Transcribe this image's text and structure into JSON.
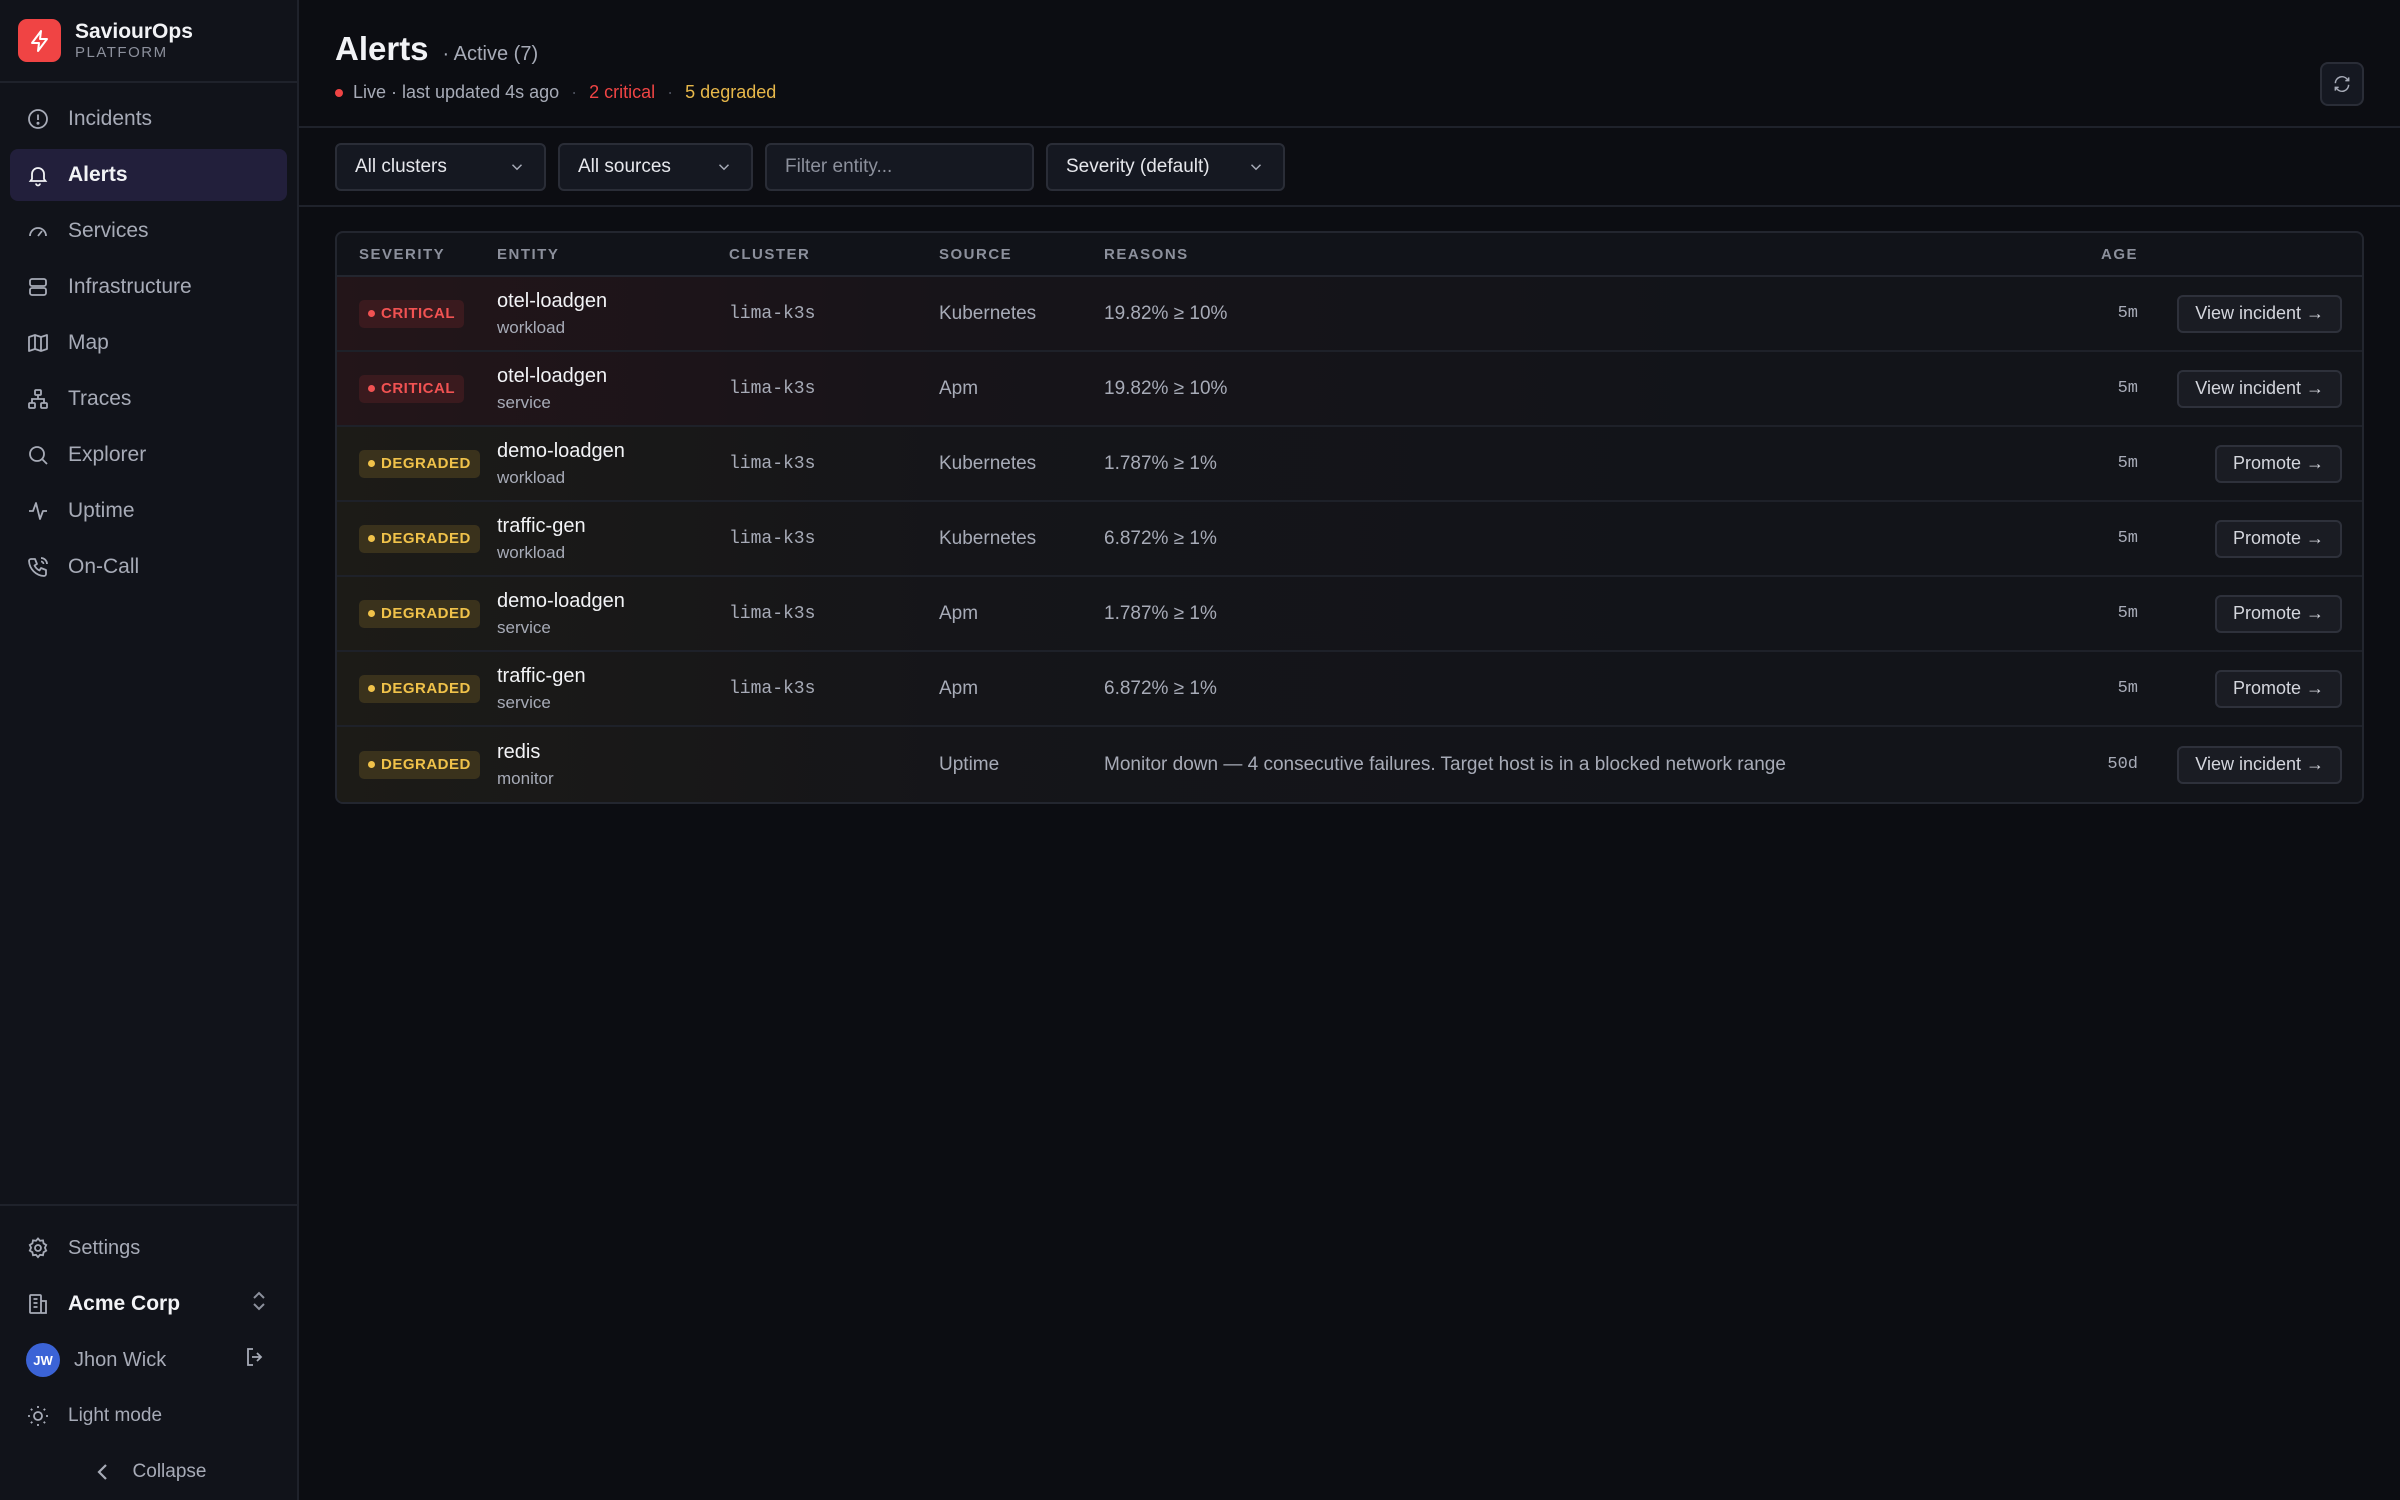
{
  "brand": {
    "name": "SaviourOps",
    "sub": "PLATFORM"
  },
  "nav": [
    {
      "label": "Incidents",
      "icon": "alert-circle-icon",
      "active": false
    },
    {
      "label": "Alerts",
      "icon": "bell-icon",
      "active": true
    },
    {
      "label": "Services",
      "icon": "gauge-icon",
      "active": false
    },
    {
      "label": "Infrastructure",
      "icon": "server-icon",
      "active": false
    },
    {
      "label": "Map",
      "icon": "map-icon",
      "active": false
    },
    {
      "label": "Traces",
      "icon": "network-icon",
      "active": false
    },
    {
      "label": "Explorer",
      "icon": "search-icon",
      "active": false
    },
    {
      "label": "Uptime",
      "icon": "activity-icon",
      "active": false
    },
    {
      "label": "On-Call",
      "icon": "phone-icon",
      "active": false
    }
  ],
  "bottom": {
    "settings": "Settings",
    "org": "Acme Corp",
    "user": {
      "initials": "JW",
      "name": "Jhon Wick"
    },
    "theme": "Light mode",
    "collapse": "Collapse"
  },
  "header": {
    "title": "Alerts",
    "subtitle": "· Active (7)",
    "live": "Live · last updated 4s ago",
    "sep": "·",
    "critical": "2 critical",
    "degraded": "5 degraded"
  },
  "filters": {
    "cluster": "All clusters",
    "source": "All sources",
    "entity_placeholder": "Filter entity...",
    "severity": "Severity (default)"
  },
  "table": {
    "headers": {
      "severity": "SEVERITY",
      "entity": "ENTITY",
      "cluster": "CLUSTER",
      "source": "SOURCE",
      "reasons": "REASONS",
      "age": "AGE"
    },
    "rows": [
      {
        "severity": "CRITICAL",
        "level": "critical",
        "entity": "otel-loadgen",
        "kind": "workload",
        "cluster": "lima-k3s",
        "source": "Kubernetes",
        "reason": "19.82% ≥ 10%",
        "age": "5m",
        "action": "View incident →"
      },
      {
        "severity": "CRITICAL",
        "level": "critical",
        "entity": "otel-loadgen",
        "kind": "service",
        "cluster": "lima-k3s",
        "source": "Apm",
        "reason": "19.82% ≥ 10%",
        "age": "5m",
        "action": "View incident →"
      },
      {
        "severity": "DEGRADED",
        "level": "degraded",
        "entity": "demo-loadgen",
        "kind": "workload",
        "cluster": "lima-k3s",
        "source": "Kubernetes",
        "reason": "1.787% ≥ 1%",
        "age": "5m",
        "action": "Promote →"
      },
      {
        "severity": "DEGRADED",
        "level": "degraded",
        "entity": "traffic-gen",
        "kind": "workload",
        "cluster": "lima-k3s",
        "source": "Kubernetes",
        "reason": "6.872% ≥ 1%",
        "age": "5m",
        "action": "Promote →"
      },
      {
        "severity": "DEGRADED",
        "level": "degraded",
        "entity": "demo-loadgen",
        "kind": "service",
        "cluster": "lima-k3s",
        "source": "Apm",
        "reason": "1.787% ≥ 1%",
        "age": "5m",
        "action": "Promote →"
      },
      {
        "severity": "DEGRADED",
        "level": "degraded",
        "entity": "traffic-gen",
        "kind": "service",
        "cluster": "lima-k3s",
        "source": "Apm",
        "reason": "6.872% ≥ 1%",
        "age": "5m",
        "action": "Promote →"
      },
      {
        "severity": "DEGRADED",
        "level": "degraded",
        "entity": "redis",
        "kind": "monitor",
        "cluster": "",
        "source": "Uptime",
        "reason": "Monitor down — 4 consecutive failures. Target host is in a blocked network range",
        "age": "50d",
        "action": "View incident →"
      }
    ]
  },
  "colors": {
    "critical": "#ef4444",
    "degraded": "#e8b84a",
    "accent": "#221f3b",
    "brand": "#f04444"
  }
}
